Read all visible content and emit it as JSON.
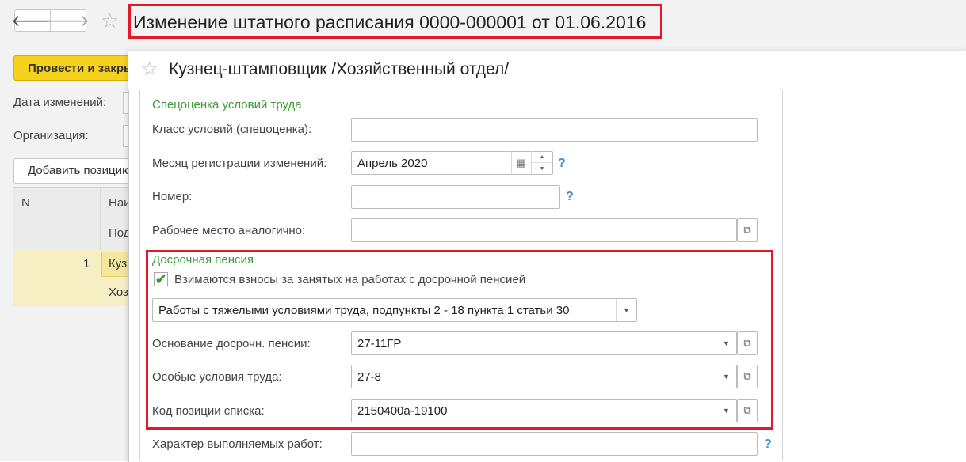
{
  "window": {
    "title": "Изменение штатного расписания 0000-000001 от 01.06.2016",
    "nav_back_icon": "arrow-left-icon",
    "nav_forward_icon": "arrow-right-icon"
  },
  "document": {
    "post_close_button": "Провести и закрыть",
    "change_date_label": "Дата изменений:",
    "organization_label": "Организация:",
    "add_position_button": "Добавить позицию",
    "table": {
      "col_n": "N",
      "col_name_top": "Наименование",
      "col_name_bottom": "Подразделение",
      "rows": [
        {
          "n": "1",
          "name": "Кузнец-штамповщик",
          "department": "Хозяйственный отдел"
        }
      ]
    }
  },
  "modal": {
    "title": "Кузнец-штамповщик /Хозяйственный отдел/",
    "special_assessment": {
      "section_title": "Спецоценка условий труда",
      "class_label": "Класс условий (спецоценка):",
      "class_value": "",
      "reg_month_label": "Месяц регистрации изменений:",
      "reg_month_value": "Апрель 2020",
      "number_label": "Номер:",
      "number_value": "",
      "workplace_label": "Рабочее место аналогично:",
      "workplace_value": ""
    },
    "early_pension": {
      "section_title": "Досрочная пенсия",
      "checkbox_label": "Взимаются взносы за занятых на работах с досрочной пенсией",
      "checkbox_checked": true,
      "work_type_value": "Работы с тяжелыми условиями труда, подпункты 2 - 18 пункта 1 статьи 30",
      "basis_label": "Основание досрочн. пенсии:",
      "basis_value": "27-11ГР",
      "special_conditions_label": "Особые условия труда:",
      "special_conditions_value": "27-8",
      "list_code_label": "Код позиции списка:",
      "list_code_value": "2150400а-19100"
    },
    "work_nature_label": "Характер выполняемых работ:",
    "work_nature_value": "",
    "help_text": "?"
  },
  "colors": {
    "accent_yellow": "#f5d21c",
    "highlight_red": "#e0182a",
    "section_green": "#3c9a38",
    "help_blue": "#3b8fd6"
  }
}
